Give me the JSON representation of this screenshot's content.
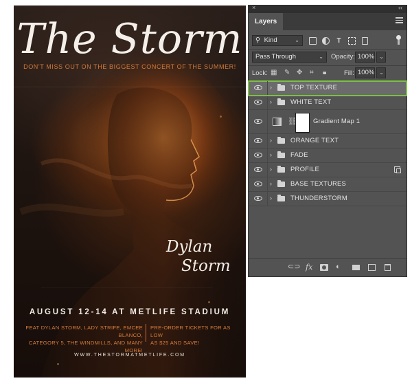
{
  "poster": {
    "title": "The Storm",
    "tagline": "DON'T MISS OUT ON THE BIGGEST CONCERT OF THE SUMMER!",
    "artist_first": "Dylan",
    "artist_last": "Storm",
    "date_line": "AUGUST 12-14 AT METLIFE STADIUM",
    "lineup_line1": "FEAT DYLAN STORM, LADY STRIFE, EMCEE BLANCO,",
    "lineup_line2": "CATEGORY 5, THE WINDMILLS, AND MANY MORE!",
    "tickets_line1": "PRE-ORDER TICKETS FOR AS LOW",
    "tickets_line2": "AS $25 AND SAVE!",
    "url": "WWW.THESTORMATMETLIFE.COM",
    "accent_color": "#d27a3b"
  },
  "panel": {
    "close_glyph": "×",
    "collapse_glyph": "‹‹",
    "tab_label": "Layers",
    "filter_kind": "Kind",
    "search_glyph": "⚲",
    "blend_mode": "Pass Through",
    "opacity_label": "Opacity:",
    "opacity_value": "100%",
    "lock_label": "Lock:",
    "fill_label": "Fill:",
    "fill_value": "100%",
    "chevron_glyph": "⌄",
    "caret_glyph": "›",
    "link_glyph": "⛓",
    "layers": [
      {
        "name": "TOP TEXTURE",
        "type": "group",
        "selected": true
      },
      {
        "name": "WHITE TEXT",
        "type": "group"
      },
      {
        "name": "Gradient Map 1",
        "type": "adjustment"
      },
      {
        "name": "ORANGE TEXT",
        "type": "group"
      },
      {
        "name": "FADE",
        "type": "group"
      },
      {
        "name": "PROFILE",
        "type": "group",
        "badge": "smart-object-icon"
      },
      {
        "name": "BASE TEXTURES",
        "type": "group"
      },
      {
        "name": "THUNDERSTORM",
        "type": "group"
      }
    ],
    "footer_fx": "fx",
    "selection_color": "#7bc043"
  }
}
